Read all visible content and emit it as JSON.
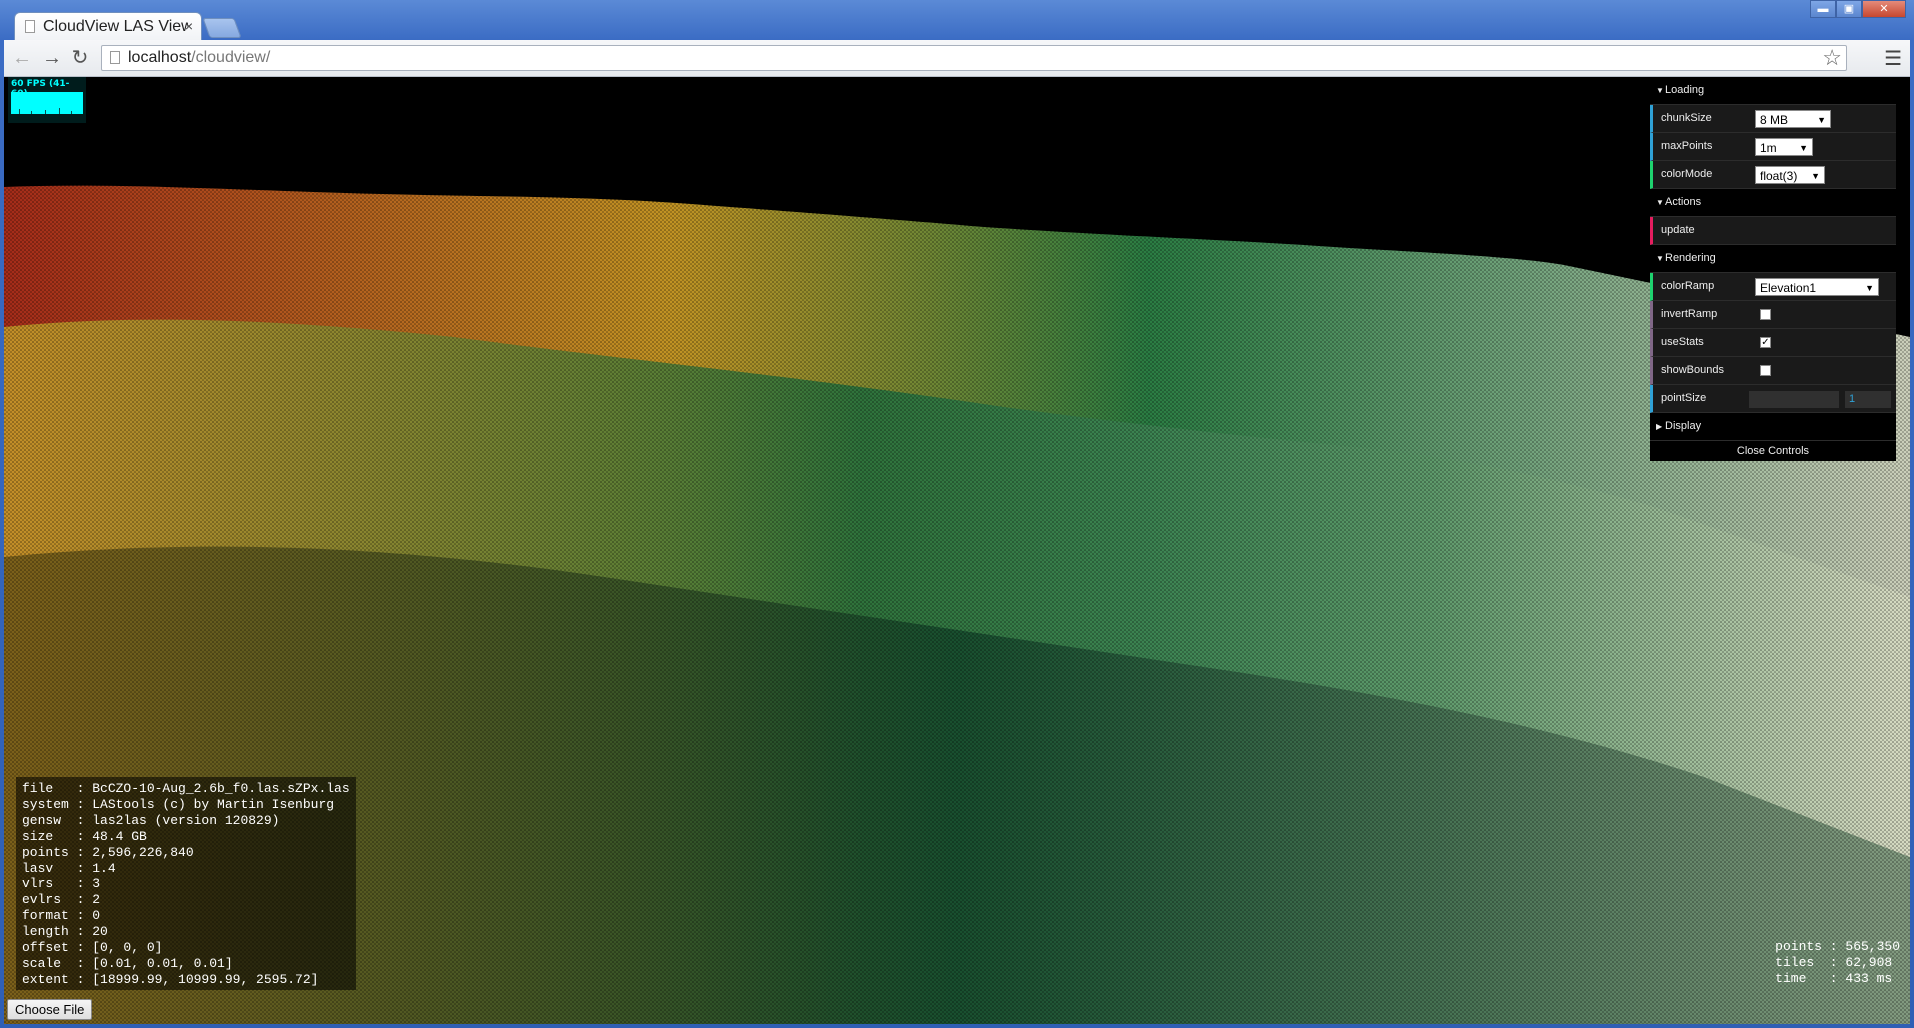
{
  "browser": {
    "tab_title": "CloudView LAS View",
    "tab_close": "×",
    "url_host": "localhost",
    "url_path": "/cloudview/",
    "window_buttons": {
      "minimize": "▬",
      "maximize": "▣",
      "close": "✕"
    }
  },
  "fps": {
    "label": "60 FPS (41-60)",
    "value": 60,
    "min": 41,
    "max": 60
  },
  "controls": {
    "loading": {
      "title": "Loading",
      "chunkSize": {
        "label": "chunkSize",
        "value": "8 MB"
      },
      "maxPoints": {
        "label": "maxPoints",
        "value": "1m"
      },
      "colorMode": {
        "label": "colorMode",
        "value": "float(3)"
      }
    },
    "actions": {
      "title": "Actions",
      "update": "update"
    },
    "rendering": {
      "title": "Rendering",
      "colorRamp": {
        "label": "colorRamp",
        "value": "Elevation1"
      },
      "invertRamp": {
        "label": "invertRamp",
        "checked": false
      },
      "useStats": {
        "label": "useStats",
        "checked": true
      },
      "showBounds": {
        "label": "showBounds",
        "checked": false
      },
      "pointSize": {
        "label": "pointSize",
        "value": "1"
      }
    },
    "display": {
      "title": "Display"
    },
    "close": "Close Controls"
  },
  "file_info": {
    "file": "BcCZO-10-Aug_2.6b_f0.las.sZPx.las",
    "system": "LAStools (c) by Martin Isenburg",
    "gensw": "las2las (version 120829)",
    "size": "48.4 GB",
    "points": "2,596,226,840",
    "lasv": "1.4",
    "vlrs": "3",
    "evlrs": "2",
    "format": "0",
    "length": "20",
    "offset": "[0, 0, 0]",
    "scale": "[0.01, 0.01, 0.01]",
    "extent": "[18999.99, 10999.99, 2595.72]"
  },
  "stats": {
    "points": "565,350",
    "tiles": "62,908",
    "time": "433 ms"
  },
  "choose_file": "Choose File",
  "colors": {
    "ramp_high": "#c0281a",
    "ramp_mid": "#e8c020",
    "ramp_low": "#1f8a4c",
    "ramp_flat": "#e8ecd0",
    "fps_accent": "#00ffff"
  }
}
